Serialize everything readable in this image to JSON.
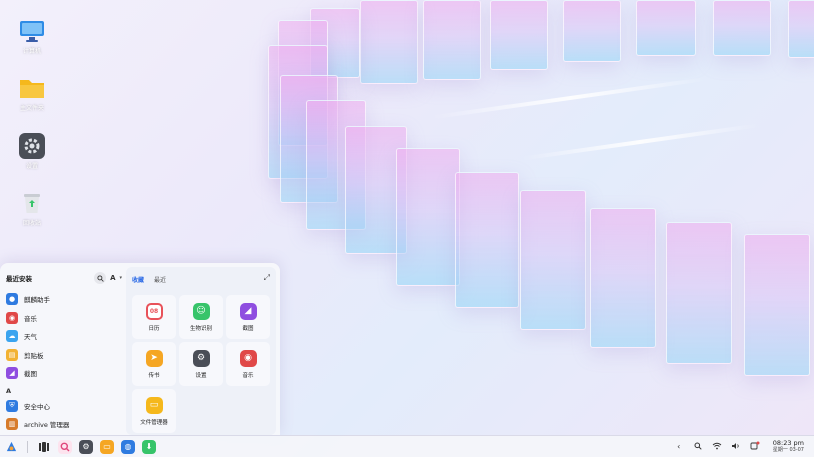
{
  "desktop": {
    "icons": [
      {
        "name": "computer",
        "label": "计算机",
        "color": "#2f8ce6"
      },
      {
        "name": "home-folder",
        "label": "主文件夹",
        "color": "#f5b81c"
      },
      {
        "name": "settings",
        "label": "设置",
        "color": "#4a4e57"
      },
      {
        "name": "trash",
        "label": "回收站",
        "color": "#d9dbe0"
      }
    ]
  },
  "start_menu": {
    "left_title": "最近安装",
    "search_icon": "search-icon",
    "letter_button": "A",
    "recent_apps": [
      {
        "label": "麒麟助手",
        "icon": "assistant-icon",
        "color": "#2f7be0"
      },
      {
        "label": "音乐",
        "icon": "music-icon",
        "color": "#e04848"
      },
      {
        "label": "天气",
        "icon": "weather-icon",
        "color": "#3ba4ef"
      },
      {
        "label": "剪贴板",
        "icon": "clipboard-icon",
        "color": "#f2b233"
      },
      {
        "label": "截图",
        "icon": "screenshot-icon",
        "color": "#8f4ee0"
      }
    ],
    "section_letter": "A",
    "letter_apps": [
      {
        "label": "安全中心",
        "icon": "security-icon",
        "color": "#2f7be0"
      },
      {
        "label": "archive 管理器",
        "icon": "archive-icon",
        "color": "#d77b2a"
      }
    ],
    "tabs": [
      {
        "label": "收藏",
        "active": true
      },
      {
        "label": "最近",
        "active": false
      }
    ],
    "favorites": [
      {
        "label": "日历",
        "icon": "calendar-icon",
        "color": "#e8525a"
      },
      {
        "label": "生物识别",
        "icon": "biometric-icon",
        "color": "#37c46a"
      },
      {
        "label": "截图",
        "icon": "screenshot-icon",
        "color": "#8f4ee0"
      },
      {
        "label": "传书",
        "icon": "transfer-icon",
        "color": "#f5a623"
      },
      {
        "label": "设置",
        "icon": "settings-icon",
        "color": "#4a4e57"
      },
      {
        "label": "音乐",
        "icon": "music-icon",
        "color": "#e04848"
      },
      {
        "label": "文件管理器",
        "icon": "folder-icon",
        "color": "#f5b81c"
      }
    ]
  },
  "taskbar": {
    "apps": [
      {
        "icon": "start-menu-icon",
        "color": "#2f7be0"
      },
      {
        "icon": "multitask-icon",
        "color": "#333333"
      },
      {
        "icon": "search-app-icon",
        "color": "#e0457a"
      },
      {
        "icon": "settings-icon",
        "color": "#4a4e57"
      },
      {
        "icon": "folder-icon",
        "color": "#f5a623"
      },
      {
        "icon": "browser-icon",
        "color": "#2f7be0"
      },
      {
        "icon": "store-icon",
        "color": "#37c46a"
      }
    ],
    "time": "08:23 pm",
    "date": "星期一 03-07"
  }
}
